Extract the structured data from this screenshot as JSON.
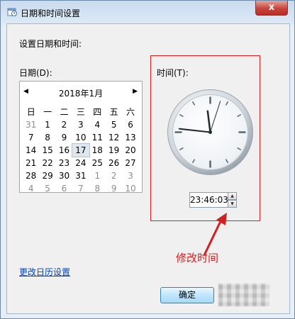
{
  "window": {
    "title": "日期和时间设置",
    "close_label": "x"
  },
  "dialog": {
    "heading": "设置日期和时间:",
    "date_label": "日期(D):",
    "time_label": "时间(T):",
    "calendar_link": "更改日历设置",
    "ok_label": "确定"
  },
  "calendar": {
    "prev_icon": "triangle-left-icon",
    "next_icon": "triangle-right-icon",
    "month_title": "2018年1月",
    "weekdays": [
      "日",
      "一",
      "二",
      "三",
      "四",
      "五",
      "六"
    ],
    "weeks": [
      [
        "31",
        "1",
        "2",
        "3",
        "4",
        "5",
        "6"
      ],
      [
        "7",
        "8",
        "9",
        "10",
        "11",
        "12",
        "13"
      ],
      [
        "14",
        "15",
        "16",
        "17",
        "18",
        "19",
        "20"
      ],
      [
        "21",
        "22",
        "23",
        "24",
        "25",
        "26",
        "27"
      ],
      [
        "28",
        "29",
        "30",
        "31",
        "1",
        "2",
        "3"
      ],
      [
        "4",
        "5",
        "6",
        "7",
        "8",
        "9",
        "10"
      ]
    ],
    "selected_day": "17"
  },
  "clock": {
    "time_value": "23:46:03",
    "hour": 23,
    "minute": 46,
    "second": 3
  },
  "annotation": {
    "text": "修改时间",
    "color": "#d02020"
  }
}
